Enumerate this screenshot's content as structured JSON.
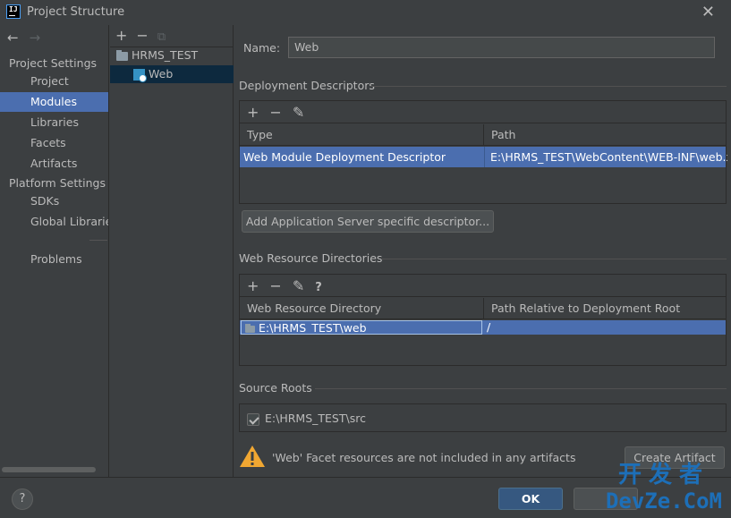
{
  "window": {
    "title": "Project Structure",
    "close_glyph": "✕"
  },
  "nav": {
    "back_glyph": "←",
    "forward_glyph": "→",
    "sections": [
      {
        "label": "Project Settings",
        "items": [
          "Project",
          "Modules",
          "Libraries",
          "Facets",
          "Artifacts"
        ]
      },
      {
        "label": "Platform Settings",
        "items": [
          "SDKs",
          "Global Libraries"
        ]
      }
    ],
    "problems": "Problems",
    "selected": "Modules"
  },
  "tree": {
    "add_glyph": "+",
    "remove_glyph": "−",
    "copy_glyph": "⧉",
    "items": [
      {
        "label": "HRMS_TEST",
        "icon": "folder-icon"
      },
      {
        "label": "Web",
        "icon": "web-facet-icon",
        "selected": true
      }
    ]
  },
  "form": {
    "name_label": "Name:",
    "name_value": "Web"
  },
  "deployment": {
    "title": "Deployment Descriptors",
    "toolbar": [
      "+",
      "−",
      "✎"
    ],
    "columns": [
      "Type",
      "Path"
    ],
    "rows": [
      {
        "type": "Web Module Deployment Descriptor",
        "path": "E:\\HRMS_TEST\\WebContent\\WEB-INF\\web.xml"
      }
    ],
    "add_button": "Add Application Server specific descriptor..."
  },
  "resources": {
    "title": "Web Resource Directories",
    "toolbar": [
      "+",
      "−",
      "✎",
      "?"
    ],
    "columns": [
      "Web Resource Directory",
      "Path Relative to Deployment Root"
    ],
    "rows": [
      {
        "directory": "E:\\HRMS_TEST\\web",
        "relative": "/"
      }
    ]
  },
  "source_roots": {
    "title": "Source Roots",
    "items": [
      {
        "label": "E:\\HRMS_TEST\\src",
        "checked": true
      }
    ]
  },
  "warning": {
    "message": "'Web' Facet resources are not included in any artifacts",
    "action": "Create Artifact"
  },
  "footer": {
    "help": "?",
    "ok": "OK"
  },
  "watermark": {
    "line1": "开发者",
    "line2": "DevZe.CoM"
  },
  "colors": {
    "background": "#3c3f41",
    "selection": "#4b6eaf",
    "primary_button": "#365880"
  }
}
